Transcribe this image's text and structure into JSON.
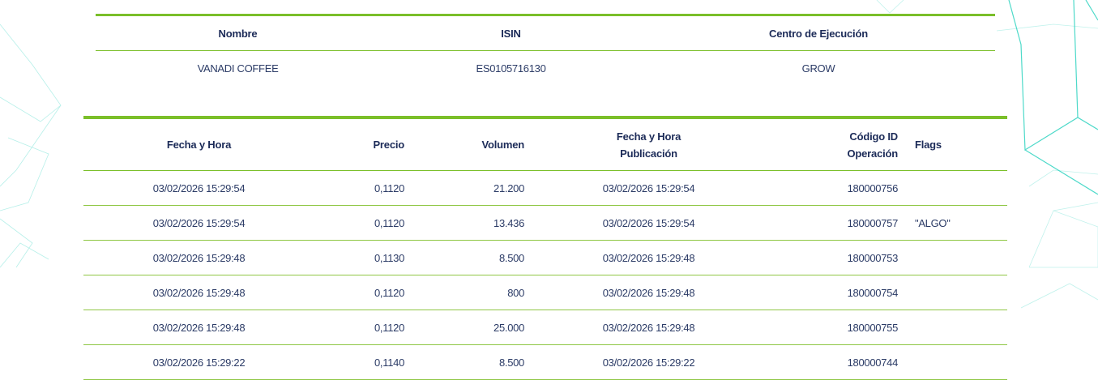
{
  "instrument": {
    "headers": {
      "name": "Nombre",
      "isin": "ISIN",
      "venue": "Centro de Ejecución"
    },
    "values": {
      "name": "VANADI COFFEE",
      "isin": "ES0105716130",
      "venue": "GROW"
    }
  },
  "trades": {
    "headers": {
      "datetime": "Fecha y Hora",
      "price": "Precio",
      "volume": "Volumen",
      "pub_line1": "Fecha y Hora",
      "pub_line2": "Publicación",
      "opid_line1": "Código ID",
      "opid_line2": "Operación",
      "flags": "Flags"
    },
    "rows": [
      {
        "datetime": "03/02/2026 15:29:54",
        "price": "0,1120",
        "volume": "21.200",
        "published": "03/02/2026 15:29:54",
        "op_id": "180000756",
        "flags": ""
      },
      {
        "datetime": "03/02/2026 15:29:54",
        "price": "0,1120",
        "volume": "13.436",
        "published": "03/02/2026 15:29:54",
        "op_id": "180000757",
        "flags": "\"ALGO\""
      },
      {
        "datetime": "03/02/2026 15:29:48",
        "price": "0,1130",
        "volume": "8.500",
        "published": "03/02/2026 15:29:48",
        "op_id": "180000753",
        "flags": ""
      },
      {
        "datetime": "03/02/2026 15:29:48",
        "price": "0,1120",
        "volume": "800",
        "published": "03/02/2026 15:29:48",
        "op_id": "180000754",
        "flags": ""
      },
      {
        "datetime": "03/02/2026 15:29:48",
        "price": "0,1120",
        "volume": "25.000",
        "published": "03/02/2026 15:29:48",
        "op_id": "180000755",
        "flags": ""
      },
      {
        "datetime": "03/02/2026 15:29:22",
        "price": "0,1140",
        "volume": "8.500",
        "published": "03/02/2026 15:29:22",
        "op_id": "180000744",
        "flags": ""
      }
    ]
  },
  "colors": {
    "accent_green": "#7bbf2a",
    "text_navy": "#1c2b58",
    "decoration_teal": "#2fd3c0"
  }
}
